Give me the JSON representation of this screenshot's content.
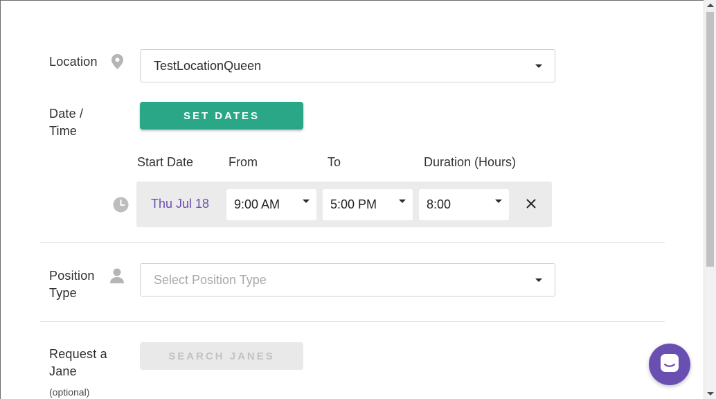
{
  "location": {
    "label": "Location",
    "selected": "TestLocationQueen"
  },
  "date_time": {
    "label_line1": "Date /",
    "label_line2": "Time",
    "set_dates_button": "SET DATES",
    "columns": {
      "start_date": "Start Date",
      "from": "From",
      "to": "To",
      "duration": "Duration (Hours)"
    },
    "shift": {
      "date": "Thu Jul 18",
      "from": "9:00 AM",
      "to": "5:00 PM",
      "duration": "8:00"
    }
  },
  "position_type": {
    "label_line1": "Position",
    "label_line2": "Type",
    "placeholder": "Select Position Type"
  },
  "request_jane": {
    "label_line1": "Request a",
    "label_line2": "Jane",
    "optional": "(optional)",
    "search_button": "SEARCH JANES"
  },
  "colors": {
    "accent_green": "#2aa786",
    "accent_purple": "#6a4fb3"
  }
}
